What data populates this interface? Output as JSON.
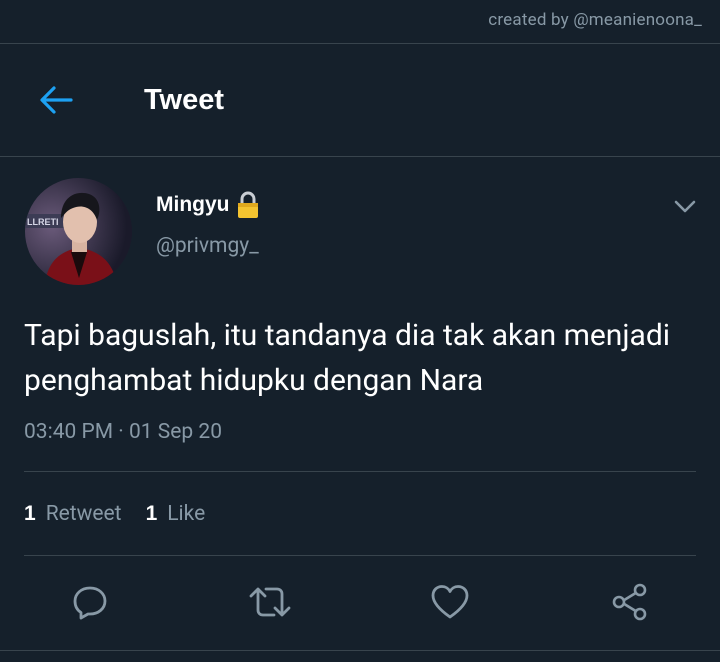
{
  "watermark": "created by @meanienoona_",
  "header": {
    "title": "Tweet",
    "back_icon": "arrow-left-icon"
  },
  "tweet": {
    "display_name": "Mingyu",
    "handle": "@privmgy_",
    "text": "Tapi baguslah, itu tandanya dia tak akan menjadi penghambat hidupku dengan Nara",
    "timestamp": "03:40 PM · 01 Sep 20",
    "retweet_count": "1",
    "retweet_label": "Retweet",
    "like_count": "1",
    "like_label": "Like"
  },
  "colors": {
    "background": "#15202b",
    "divider": "#38444d",
    "secondary_text": "#8899a6",
    "accent": "#1da1f2",
    "lock": "#f4c430"
  },
  "actions": [
    "reply-icon",
    "retweet-icon",
    "like-icon",
    "share-icon"
  ]
}
